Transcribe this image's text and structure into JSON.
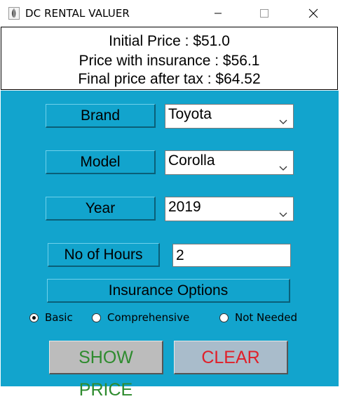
{
  "window": {
    "title": "DC RENTAL VALUER",
    "icon": "feather-app-icon",
    "controls": [
      "minimize-icon",
      "maximize-icon",
      "close-icon"
    ]
  },
  "summary": {
    "initial_price": "Initial Price : $51.0",
    "price_with_insurance": "Price with insurance : $56.1",
    "final_price": "Final price after tax : $64.52"
  },
  "form": {
    "brand": {
      "label": "Brand",
      "value": "Toyota"
    },
    "model": {
      "label": "Model",
      "value": "Corolla"
    },
    "year": {
      "label": "Year",
      "value": "2019"
    },
    "hours": {
      "label": "No of Hours",
      "value": "2"
    },
    "insurance": {
      "label": "Insurance Options",
      "options": [
        "Basic",
        "Comprehensive",
        "Not Needed"
      ],
      "selected": "Basic"
    }
  },
  "actions": {
    "show_price": "SHOW PRICE",
    "clear": "CLEAR"
  },
  "colors": {
    "background": "#12a4cd",
    "show_text": "#2e8b2e",
    "clear_text": "#e0202a"
  }
}
